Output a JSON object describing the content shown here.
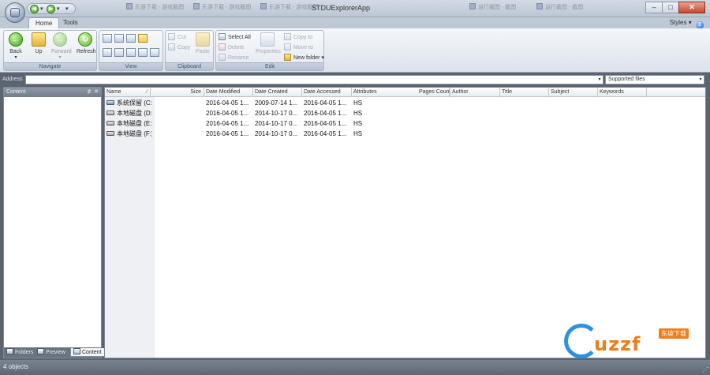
{
  "window": {
    "title": "STDUExplorerApp",
    "ghost_tasks": [
      "乐游下载 - 游戏截图",
      "乐游下载 - 游戏截图",
      "乐游下载 - 游戏截图",
      "运行截图 - 截图",
      "运行截图 - 截图"
    ],
    "controls": [
      "–",
      "□",
      "✕"
    ]
  },
  "ribbon_tabs": [
    {
      "label": "Home",
      "active": true
    },
    {
      "label": "Tools",
      "active": false
    }
  ],
  "styles_label": "Styles",
  "groups": {
    "navigate": {
      "caption": "Navigate",
      "back": "Back",
      "up": "Up",
      "forward": "Forward",
      "refresh": "Refresh"
    },
    "view": {
      "caption": "View"
    },
    "clipboard": {
      "caption": "Clipboard",
      "cut": "Cut",
      "copy": "Copy",
      "paste": "Paste"
    },
    "edit": {
      "caption": "Edit",
      "select_all": "Select All",
      "delete": "Delete",
      "rename": "Rename",
      "properties": "Properties",
      "copy_to": "Copy to",
      "move_to": "Move to",
      "new_folder": "New folder"
    }
  },
  "address": {
    "label": "Address",
    "value": "",
    "filter_value": "Supported files"
  },
  "left_pane": {
    "title": "Content",
    "tabs": [
      "Folders",
      "Preview",
      "Content"
    ]
  },
  "file_list": {
    "columns": [
      "Name",
      "Size",
      "Date Modified",
      "Date Created",
      "Date Accessed",
      "Attributes",
      "Pages Count",
      "Author",
      "Title",
      "Subject",
      "Keywords"
    ],
    "rows": [
      {
        "name": "系统保留 (C:)",
        "size": "",
        "modified": "2016-04-05 1...",
        "created": "2009-07-14 1...",
        "accessed": "2016-04-05 1...",
        "attributes": "HS",
        "system": true
      },
      {
        "name": "本地磁盘 (D:)",
        "size": "",
        "modified": "2016-04-05 1...",
        "created": "2014-10-17 0...",
        "accessed": "2016-04-05 1...",
        "attributes": "HS",
        "system": false
      },
      {
        "name": "本地磁盘 (E:)",
        "size": "",
        "modified": "2016-04-05 1...",
        "created": "2014-10-17 0...",
        "accessed": "2016-04-05 1...",
        "attributes": "HS",
        "system": false
      },
      {
        "name": "本地磁盘 (F:)",
        "size": "",
        "modified": "2016-04-05 1...",
        "created": "2014-10-17 0...",
        "accessed": "2016-04-05 1...",
        "attributes": "HS",
        "system": false
      }
    ]
  },
  "status": {
    "text": "4 objects"
  },
  "watermark": {
    "brand": "uzzf",
    "tag": "东坡下载"
  }
}
